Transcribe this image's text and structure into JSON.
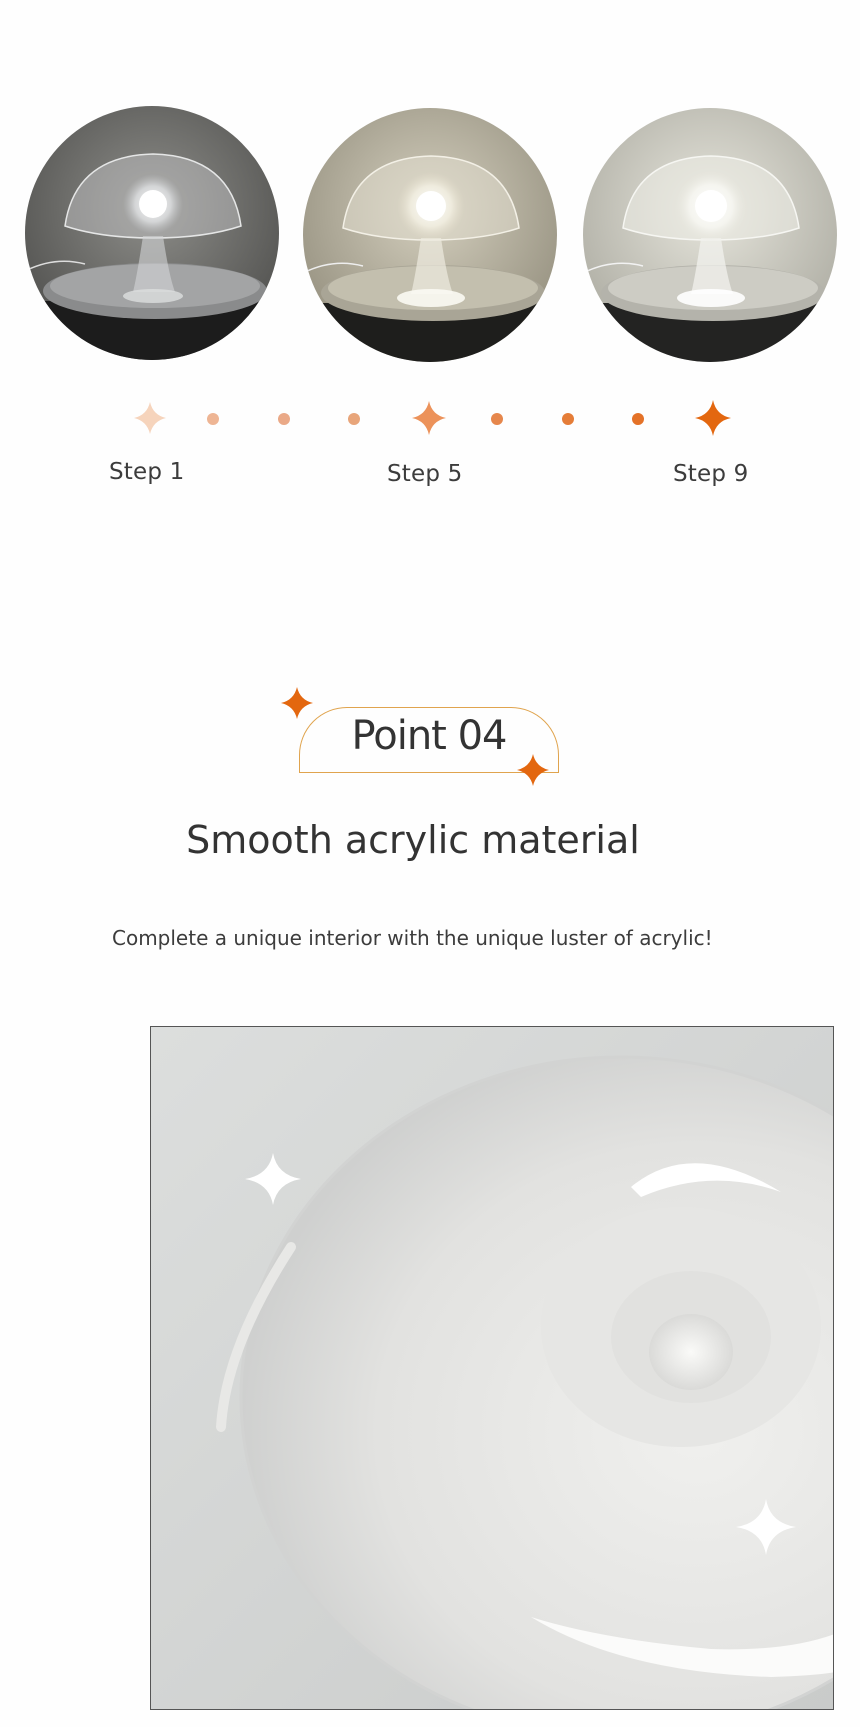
{
  "photos": [
    {
      "name": "lamp-photo-step-1",
      "icon": "lamp-dim-cool-photo"
    },
    {
      "name": "lamp-photo-step-5",
      "icon": "lamp-warm-photo"
    },
    {
      "name": "lamp-photo-step-9",
      "icon": "lamp-bright-photo"
    }
  ],
  "steps": {
    "labels": [
      "Step 1",
      "Step 5",
      "Step 9"
    ],
    "colors": {
      "light": "#f6d4bc",
      "mid_dot": "#e8a57a",
      "mid_star": "#ec925a",
      "deep": "#e3670f"
    }
  },
  "point": {
    "label": "Point 04",
    "accent_color": "#e3670f",
    "frame_color": "#e0a44e"
  },
  "headline": "Smooth acrylic material",
  "subline": "Complete a unique interior with the unique luster of acrylic!",
  "material_photo": {
    "icon": "acrylic-closeup-photo",
    "sparkle_icon": "sparkle-icon"
  }
}
